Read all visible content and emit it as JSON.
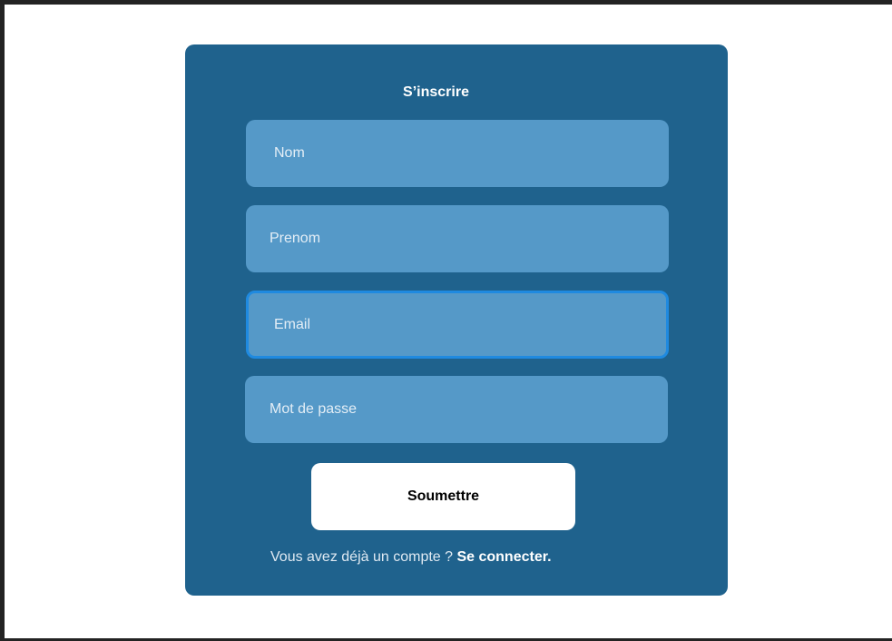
{
  "form": {
    "title": "S’inscrire",
    "fields": [
      {
        "placeholder": "Nom"
      },
      {
        "placeholder": "Prenom"
      },
      {
        "placeholder": "Email"
      },
      {
        "placeholder": "Mot de passe"
      }
    ],
    "submit_label": "Soumettre",
    "footer_text": "Vous avez déjà un compte ? ",
    "login_link": "Se connecter."
  },
  "colors": {
    "card_background": "#1f628d",
    "field_background": "#5599c8",
    "focus_border": "#1f8ae0",
    "button_background": "#ffffff"
  }
}
